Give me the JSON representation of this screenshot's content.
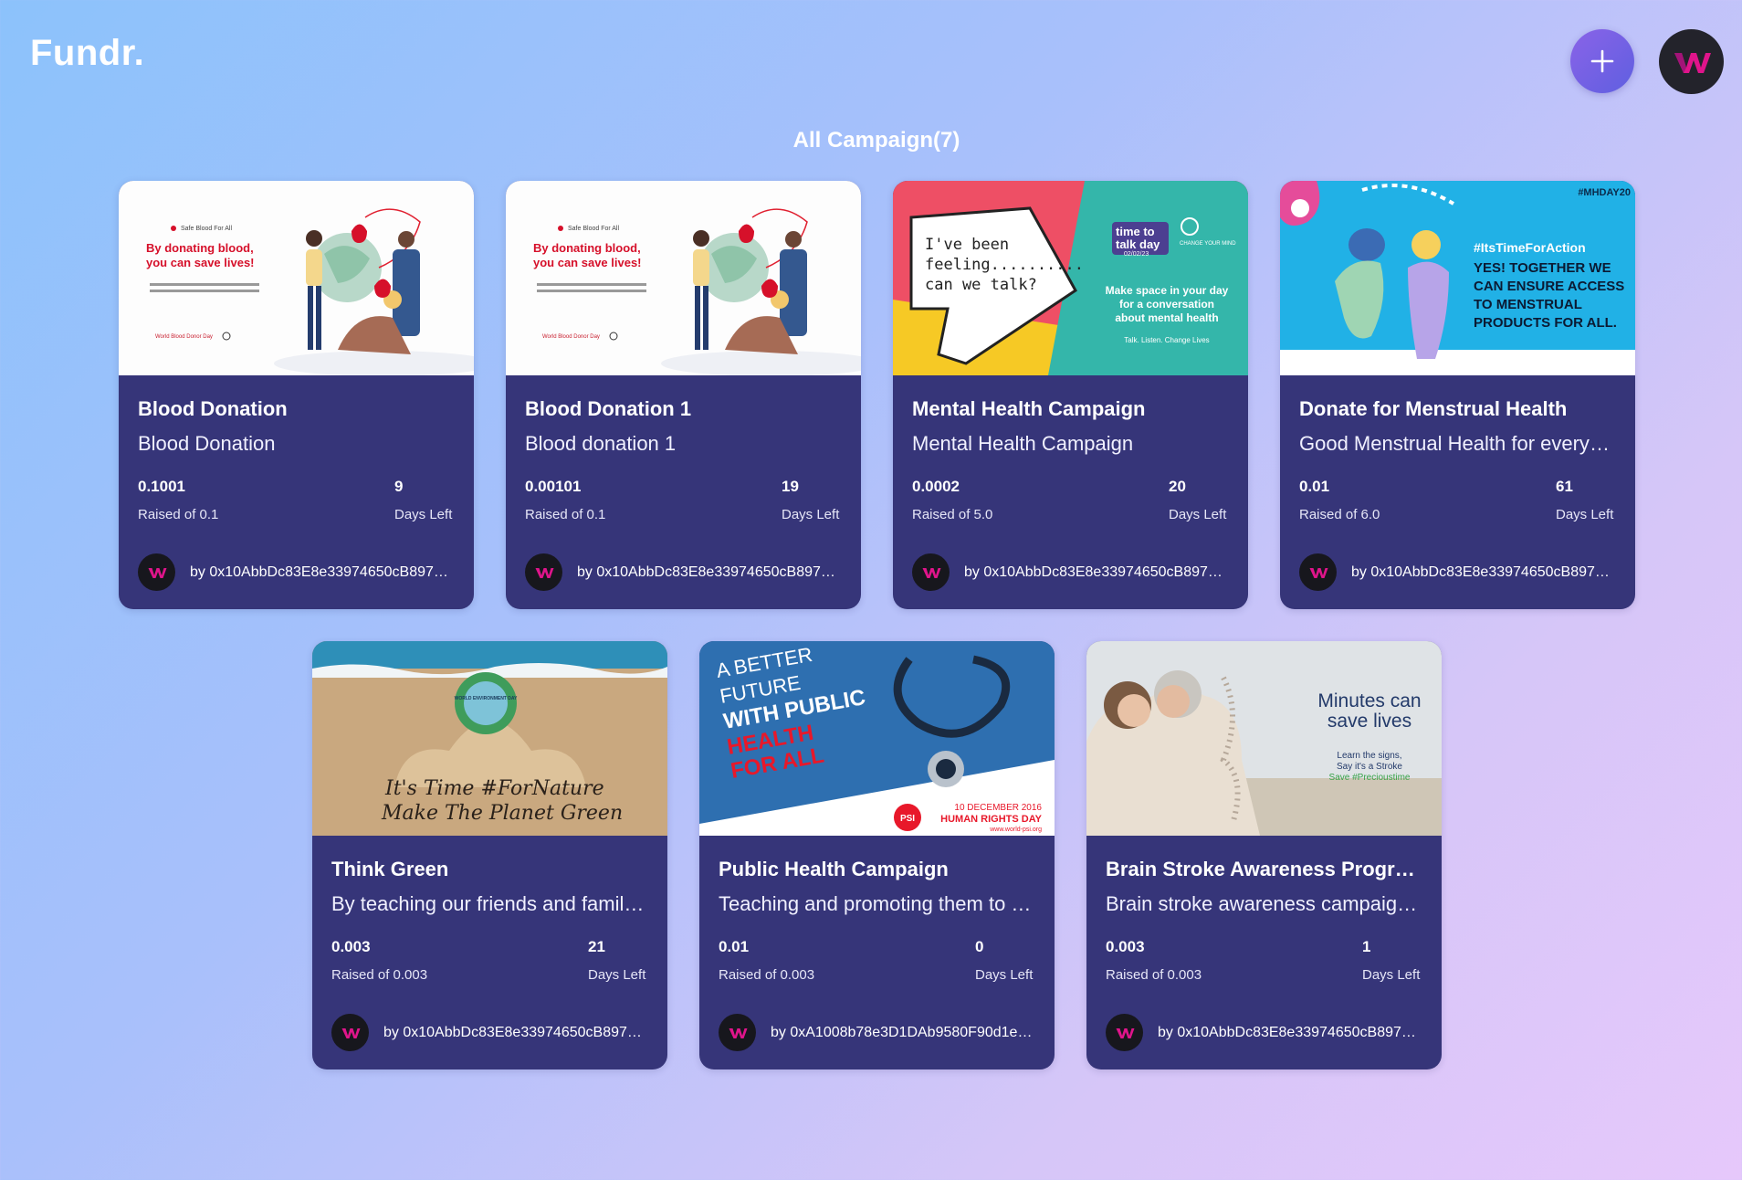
{
  "brand": {
    "logo": "Fundr."
  },
  "header": {
    "add_icon": "plus-icon",
    "avatar_icon": "w-logo-icon"
  },
  "main": {
    "heading": "All Campaign(7)"
  },
  "campaigns": [
    {
      "title": "Blood Donation",
      "description": "Blood Donation",
      "raised": "0.1001",
      "raised_label": "Raised of 0.1",
      "days": "9",
      "days_label": "Days Left",
      "owner": "by 0x10AbbDc83E8e33974650cB897b…",
      "image_text": {
        "brand": "Safe Blood For All",
        "headline1": "By donating blood,",
        "headline2": "you can save lives!",
        "body": "Everyone should have access to safe blood transfusions, when and where they need them.",
        "footer": "World Blood Donor Day"
      }
    },
    {
      "title": "Blood Donation 1",
      "description": "Blood donation 1",
      "raised": "0.00101",
      "raised_label": "Raised of 0.1",
      "days": "19",
      "days_label": "Days Left",
      "owner": "by 0x10AbbDc83E8e33974650cB897b…",
      "image_text": {
        "brand": "Safe Blood For All",
        "headline1": "By donating blood,",
        "headline2": "you can save lives!",
        "body": "Everyone should have access to safe blood transfusions, when and where they need them.",
        "footer": "World Blood Donor Day"
      }
    },
    {
      "title": "Mental Health Campaign",
      "description": "Mental Health Campaign",
      "raised": "0.0002",
      "raised_label": "Raised of 5.0",
      "days": "20",
      "days_label": "Days Left",
      "owner": "by 0x10AbbDc83E8e33974650cB897b…",
      "image_text": {
        "bubble1": "I've been",
        "bubble2": "feeling..........",
        "bubble3": "can we talk?",
        "badge1": "time to",
        "badge2": "talk day",
        "date": "02/02/23",
        "org": "CHANGE YOUR MIND",
        "msg1": "Make space in your day",
        "msg2": "for a conversation",
        "msg3": "about mental health",
        "tag": "Talk. Listen. Change Lives"
      }
    },
    {
      "title": "Donate for Menstrual Health",
      "description": "Good Menstrual Health for everyo…",
      "raised": "0.01",
      "raised_label": "Raised of 6.0",
      "days": "61",
      "days_label": "Days Left",
      "owner": "by 0x10AbbDc83E8e33974650cB897b…",
      "image_text": {
        "tag": "#MHDAY20",
        "hashtag": "#ItsTimeForAction",
        "l1": "YES! TOGETHER WE",
        "l2": "CAN ENSURE ACCESS",
        "l3": "TO MENSTRUAL",
        "l4": "PRODUCTS FOR ALL."
      }
    },
    {
      "title": "Think Green",
      "description": "By teaching our friends and family…",
      "raised": "0.003",
      "raised_label": "Raised of 0.003",
      "days": "21",
      "days_label": "Days Left",
      "owner": "by 0x10AbbDc83E8e33974650cB897b…",
      "image_text": {
        "globe": "WORLD ENVIRONMENT DAY",
        "l1": "It's Time #ForNature",
        "l2": "Make The Planet Green"
      }
    },
    {
      "title": "Public Health Campaign",
      "description": "Teaching and promoting them to …",
      "raised": "0.01",
      "raised_label": "Raised of 0.003",
      "days": "0",
      "days_label": "Days Left",
      "owner": "by 0xA1008b78e3D1DAb9580F90d1eA…",
      "image_text": {
        "l1": "A BETTER",
        "l2": "FUTURE",
        "l3": "WITH PUBLIC",
        "l4": "HEALTH",
        "l5": "FOR ALL",
        "date": "10 DECEMBER 2016",
        "event": "HUMAN RIGHTS DAY",
        "url": "www.world-psi.org",
        "logo": "PSI"
      }
    },
    {
      "title": "Brain Stroke Awareness Program",
      "description": "Brain stroke awareness campaigns…",
      "raised": "0.003",
      "raised_label": "Raised of 0.003",
      "days": "1",
      "days_label": "Days Left",
      "owner": "by 0x10AbbDc83E8e33974650cB897b…",
      "image_text": {
        "l1": "Minutes can",
        "l2": "save lives",
        "s1": "Learn the signs,",
        "s2": "Say it's a Stroke",
        "s3": "Save #Precioustime"
      }
    }
  ],
  "colors": {
    "card_bg": "#363579",
    "accent_magenta": "#e0148b",
    "add_button": "#7060e6"
  }
}
